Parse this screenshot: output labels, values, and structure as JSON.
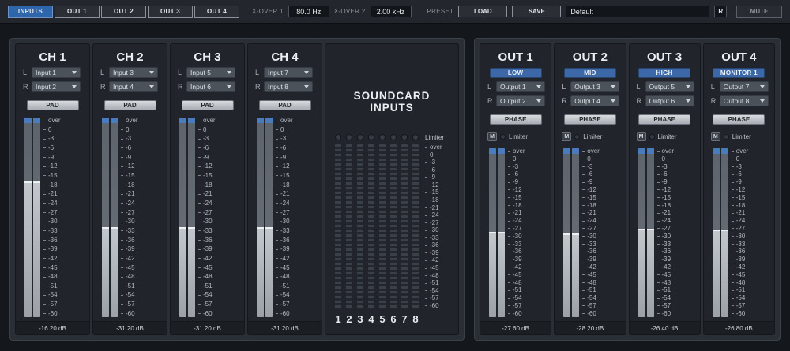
{
  "colors": {
    "accent_blue": "#2e66ab",
    "band_blue": "#3c68a8",
    "meter_cap": "#4a7cbd"
  },
  "topbar": {
    "tabs": [
      {
        "label": "INPUTS",
        "active": true
      },
      {
        "label": "OUT 1",
        "active": false
      },
      {
        "label": "OUT 2",
        "active": false
      },
      {
        "label": "OUT 3",
        "active": false
      },
      {
        "label": "OUT 4",
        "active": false
      }
    ],
    "xover1_label": "X-OVER 1",
    "xover1_value": "80.0 Hz",
    "xover2_label": "X-OVER 2",
    "xover2_value": "2.00 kHz",
    "preset_label": "PRESET",
    "load_label": "LOAD",
    "save_label": "SAVE",
    "preset_value": "Default",
    "r_label": "R",
    "mute_label": "MUTE"
  },
  "labels": {
    "l": "L",
    "r": "R",
    "pad": "PAD",
    "phase": "PHASE",
    "m": "M",
    "limiter": "Limiter"
  },
  "meter_scale": [
    "over",
    "0",
    "-3",
    "-6",
    "-9",
    "-12",
    "-15",
    "-18",
    "-21",
    "-24",
    "-27",
    "-30",
    "-33",
    "-36",
    "-39",
    "-42",
    "-45",
    "-48",
    "-51",
    "-54",
    "-57",
    "-60"
  ],
  "inputs": {
    "channels": [
      {
        "title": "CH 1",
        "l": "Input 1",
        "r": "Input 2",
        "readout": "-16.20 dB",
        "level_db": -16.2
      },
      {
        "title": "CH 2",
        "l": "Input 3",
        "r": "Input 4",
        "readout": "-31.20 dB",
        "level_db": -31.2
      },
      {
        "title": "CH 3",
        "l": "Input 5",
        "r": "Input 6",
        "readout": "-31.20 dB",
        "level_db": -31.2
      },
      {
        "title": "CH 4",
        "l": "Input 7",
        "r": "Input 8",
        "readout": "-31.20 dB",
        "level_db": -31.2
      }
    ]
  },
  "soundcard": {
    "title": "SOUNDCARD INPUTS",
    "limiter_label": "Limiter",
    "channel_numbers": [
      "1",
      "2",
      "3",
      "4",
      "5",
      "6",
      "7",
      "8"
    ]
  },
  "outputs": {
    "channels": [
      {
        "title": "OUT 1",
        "band": "LOW",
        "l": "Output 1",
        "r": "Output 2",
        "readout": "-27.60 dB",
        "level_db": -27.6
      },
      {
        "title": "OUT 2",
        "band": "MID",
        "l": "Output 3",
        "r": "Output 4",
        "readout": "-28.20 dB",
        "level_db": -28.2
      },
      {
        "title": "OUT 3",
        "band": "HIGH",
        "l": "Output 5",
        "r": "Output 6",
        "readout": "-26.40 dB",
        "level_db": -26.4
      },
      {
        "title": "OUT 4",
        "band": "MONITOR 1",
        "l": "Output 7",
        "r": "Output 8",
        "readout": "-26.80 dB",
        "level_db": -26.8
      }
    ]
  }
}
